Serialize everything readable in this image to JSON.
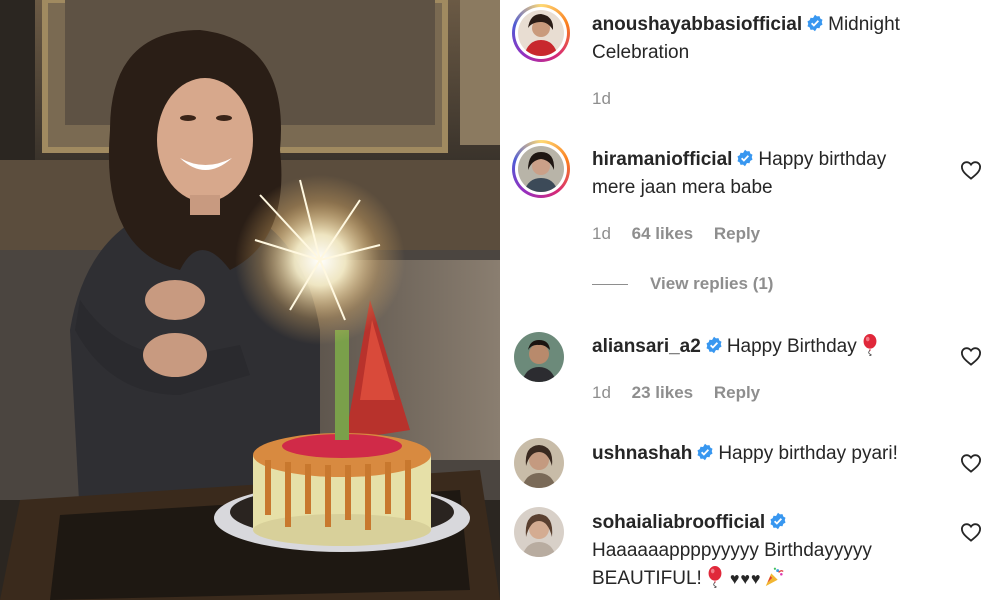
{
  "post": {
    "author": "anoushayabbasiofficial",
    "caption": "Midnight Celebration",
    "time": "1d"
  },
  "comments": [
    {
      "username": "hiramaniofficial",
      "text": "Happy birthday mere jaan mera babe",
      "time": "1d",
      "likes": "64 likes",
      "reply": "Reply",
      "view_replies": "View replies (1)"
    },
    {
      "username": "aliansari_a2",
      "text": "Happy Birthday",
      "time": "1d",
      "likes": "23 likes",
      "reply": "Reply"
    },
    {
      "username": "ushnashah",
      "text": "Happy birthday pyari!"
    },
    {
      "username": "sohaialiabroofficial",
      "text": "Haaaaaappppyyyyy Birthdayyyyy BEAUTIFUL!",
      "emoji_hearts": "♥♥♥"
    }
  ],
  "icons": {
    "verified": "verified-badge-icon",
    "like": "heart-outline-icon",
    "balloon": "balloon-emoji-icon",
    "popper": "party-popper-emoji-icon"
  },
  "colors": {
    "verified_blue": "#3897f0",
    "muted_text": "#8e8e8e",
    "main_text": "#262626"
  }
}
